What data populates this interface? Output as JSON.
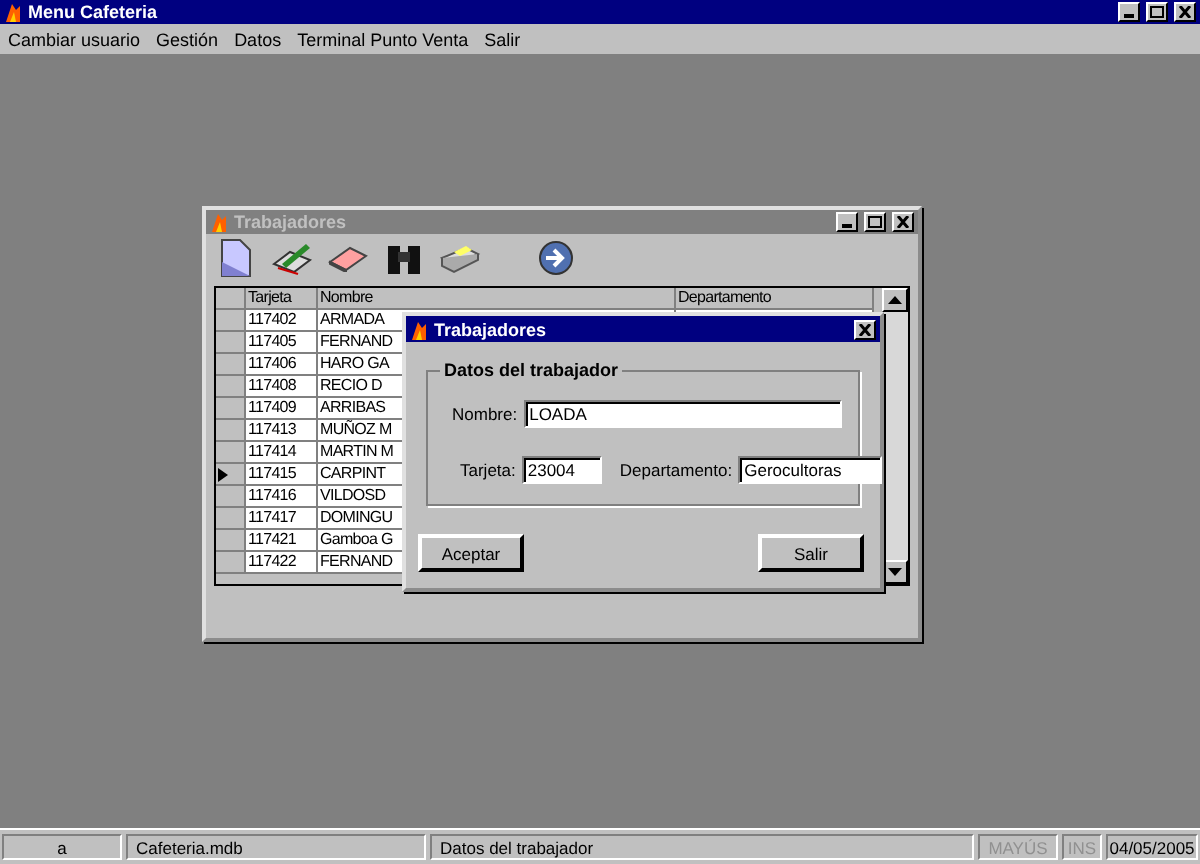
{
  "window": {
    "title": "Menu Cafeteria"
  },
  "menu": [
    "Cambiar usuario",
    "Gestión",
    "Datos",
    "Terminal Punto Venta",
    "Salir"
  ],
  "workers_window": {
    "title": "Trabajadores",
    "toolbar": [
      {
        "kind": "new"
      },
      {
        "kind": "edit"
      },
      {
        "kind": "erase"
      },
      {
        "kind": "search"
      },
      {
        "kind": "print"
      },
      {
        "kind": "forward"
      }
    ],
    "columns": [
      "Tarjeta",
      "Nombre",
      "Departamento"
    ],
    "rows": [
      {
        "card": "117402",
        "name": "ARMADA",
        "selected": false
      },
      {
        "card": "117405",
        "name": "FERNAND",
        "selected": false
      },
      {
        "card": "117406",
        "name": "HARO GA",
        "selected": false
      },
      {
        "card": "117408",
        "name": "RECIO D",
        "selected": false
      },
      {
        "card": "117409",
        "name": "ARRIBAS",
        "selected": false
      },
      {
        "card": "117413",
        "name": "MUÑOZ M",
        "selected": false
      },
      {
        "card": "117414",
        "name": "MARTIN M",
        "selected": false
      },
      {
        "card": "117415",
        "name": "CARPINT",
        "selected": true
      },
      {
        "card": "117416",
        "name": "VILDOSD",
        "selected": false
      },
      {
        "card": "117417",
        "name": "DOMINGU",
        "selected": false
      },
      {
        "card": "117421",
        "name": "Gamboa G",
        "selected": false
      },
      {
        "card": "117422",
        "name": "FERNAND",
        "selected": false
      }
    ]
  },
  "dialog": {
    "title": "Trabajadores",
    "group": "Datos del trabajador",
    "name_label": "Nombre:",
    "name_value": "LOADA",
    "card_label": "Tarjeta:",
    "card_value": "23004",
    "dept_label": "Departamento:",
    "dept_value": "Gerocultoras",
    "buttons": [
      "Aceptar",
      "Salir"
    ]
  },
  "status_bar": [
    {
      "text": "a",
      "disabled": false
    },
    {
      "text": "Cafeteria.mdb",
      "disabled": false
    },
    {
      "text": "Datos del trabajador",
      "disabled": false
    },
    {
      "text": "MAYÚS",
      "disabled": true
    },
    {
      "text": "INS",
      "disabled": true
    },
    {
      "text": "04/05/2005",
      "disabled": false
    }
  ]
}
